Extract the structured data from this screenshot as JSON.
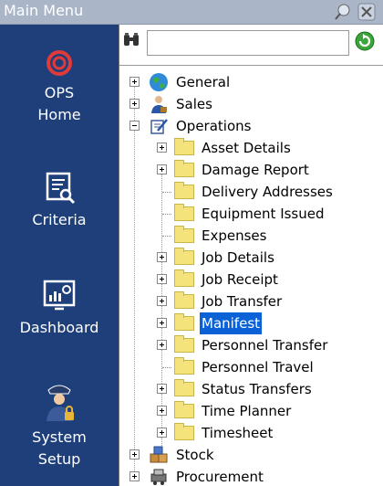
{
  "window": {
    "title": "Main Menu"
  },
  "sidebar": {
    "items": [
      {
        "label_line1": "OPS",
        "label_line2": "Home"
      },
      {
        "label_line1": "Criteria",
        "label_line2": ""
      },
      {
        "label_line1": "Dashboard",
        "label_line2": ""
      },
      {
        "label_line1": "System",
        "label_line2": "Setup"
      }
    ]
  },
  "search": {
    "value": ""
  },
  "tree": {
    "roots": [
      {
        "label": "General",
        "expanded": false
      },
      {
        "label": "Sales",
        "expanded": false
      },
      {
        "label": "Operations",
        "expanded": true
      },
      {
        "label": "Stock",
        "expanded": false
      },
      {
        "label": "Procurement",
        "expanded": false
      }
    ],
    "operations_children": [
      {
        "label": "Asset Details",
        "expandable": true
      },
      {
        "label": "Damage Report",
        "expandable": true
      },
      {
        "label": "Delivery Addresses",
        "expandable": false
      },
      {
        "label": "Equipment Issued",
        "expandable": false
      },
      {
        "label": "Expenses",
        "expandable": false
      },
      {
        "label": "Job Details",
        "expandable": true
      },
      {
        "label": "Job Receipt",
        "expandable": true
      },
      {
        "label": "Job Transfer",
        "expandable": true
      },
      {
        "label": "Manifest",
        "expandable": true,
        "selected": true
      },
      {
        "label": "Personnel Transfer",
        "expandable": true
      },
      {
        "label": "Personnel Travel",
        "expandable": false
      },
      {
        "label": "Status Transfers",
        "expandable": true
      },
      {
        "label": "Time Planner",
        "expandable": true
      },
      {
        "label": "Timesheet",
        "expandable": true
      }
    ]
  },
  "colors": {
    "sidebar_bg": "#1f3f7a",
    "selection": "#0a62d6",
    "folder": "#f3e37a"
  }
}
